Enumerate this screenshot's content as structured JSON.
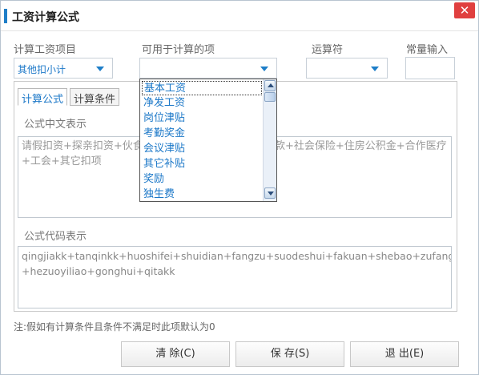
{
  "window": {
    "title": "工资计算公式",
    "close_label": "✕"
  },
  "fields": {
    "item_label": "计算工资项目",
    "item_value": "其他扣小计",
    "usable_label": "可用于计算的项",
    "usable_value": "",
    "operator_label": "运算符",
    "operator_value": "",
    "constant_label": "常量输入",
    "constant_value": ""
  },
  "dropdown": {
    "items": [
      "基本工资",
      "净发工资",
      "岗位津贴",
      "考勤奖金",
      "会议津贴",
      "其它补贴",
      "奖励",
      "独生费"
    ]
  },
  "tabs": [
    {
      "label": "计算公式"
    },
    {
      "label": "计算条件"
    }
  ],
  "formula_cn": {
    "label": "公式中文表示",
    "line1_left": "请假扣资+探亲扣资+伙食",
    "line1_right": "款+社会保险+住房公积金+合作医疗",
    "line2": "+工会+其它扣项"
  },
  "formula_code": {
    "label": "公式代码表示",
    "line1": "qingjiakk+tanqinkk+huoshifei+shuidian+fangzu+suodeshui+fakuan+shebao+zufang",
    "line2": "+hezuoyiliao+gonghui+qitakk"
  },
  "note": "注:假如有计算条件且条件不满足时此项默认为0",
  "buttons": {
    "clear": "清 除(C)",
    "save": "保 存(S)",
    "exit": "退 出(E)"
  },
  "colors": {
    "accent": "#1e7ec8",
    "close": "#e04040",
    "link_text": "#1c78c8"
  }
}
